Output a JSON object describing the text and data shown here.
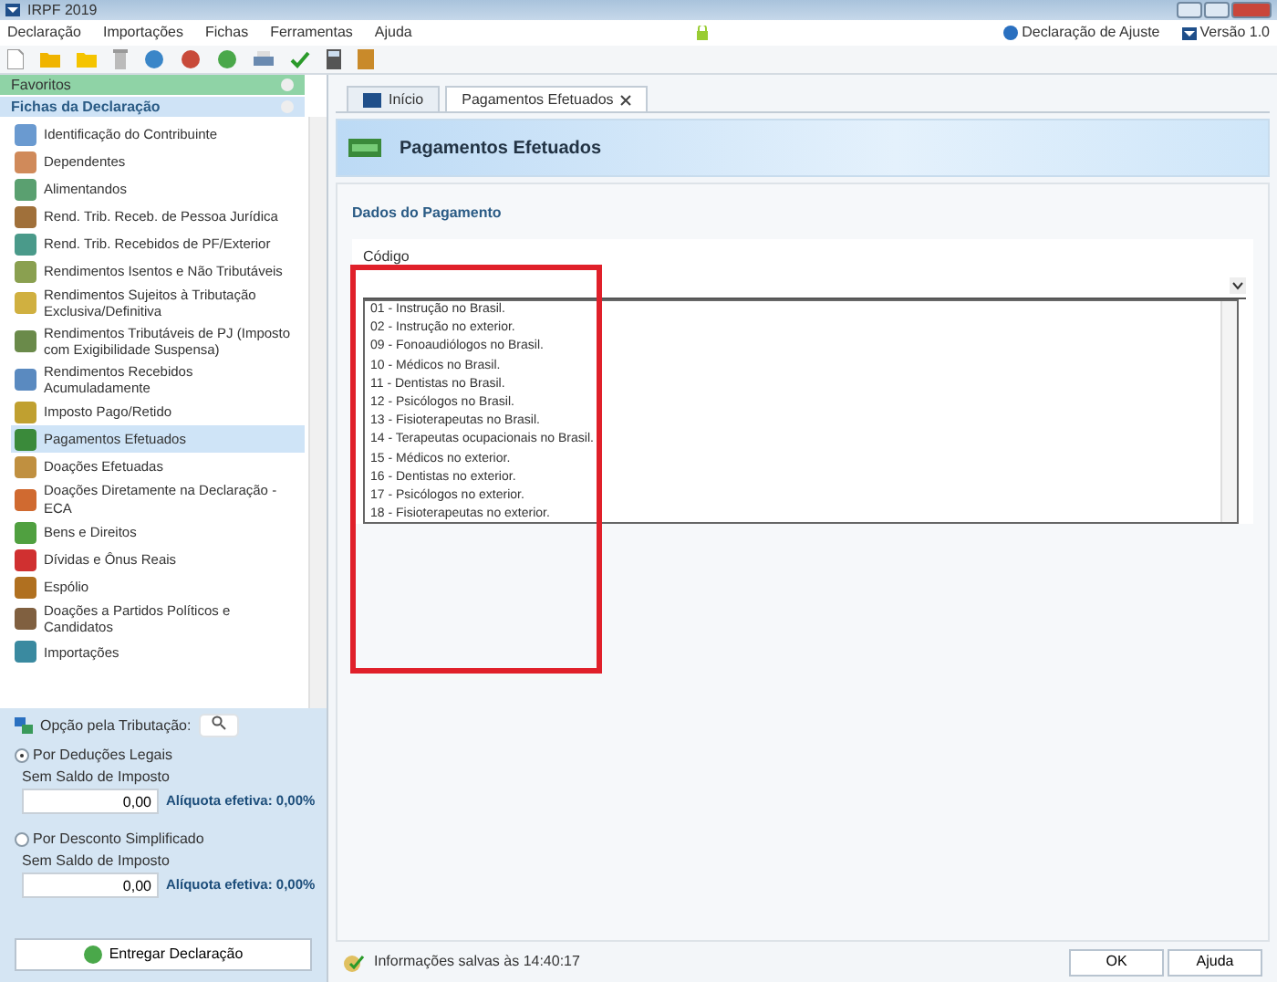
{
  "window": {
    "title": "IRPF 2019"
  },
  "menu": [
    "Declaração",
    "Importações",
    "Fichas",
    "Ferramentas",
    "Ajuda"
  ],
  "header_right": {
    "declaration": "Declaração de Ajuste",
    "version": "Versão 1.0"
  },
  "sidebar": {
    "favorites": "Favoritos",
    "section": "Fichas da Declaração",
    "items": [
      {
        "label": "Identificação do Contribuinte",
        "selected": false
      },
      {
        "label": "Dependentes",
        "selected": false
      },
      {
        "label": "Alimentandos",
        "selected": false
      },
      {
        "label": "Rend. Trib. Receb. de Pessoa Jurídica",
        "selected": false
      },
      {
        "label": "Rend. Trib. Recebidos de PF/Exterior",
        "selected": false
      },
      {
        "label": "Rendimentos Isentos e Não Tributáveis",
        "selected": false
      },
      {
        "label": "Rendimentos Sujeitos à Tributação Exclusiva/Definitiva",
        "selected": false
      },
      {
        "label": "Rendimentos Tributáveis de PJ (Imposto com Exigibilidade Suspensa)",
        "selected": false
      },
      {
        "label": "Rendimentos Recebidos Acumuladamente",
        "selected": false
      },
      {
        "label": "Imposto Pago/Retido",
        "selected": false
      },
      {
        "label": "Pagamentos Efetuados",
        "selected": true
      },
      {
        "label": "Doações Efetuadas",
        "selected": false
      },
      {
        "label": "Doações Diretamente na Declaração - ECA",
        "selected": false
      },
      {
        "label": "Bens e Direitos",
        "selected": false
      },
      {
        "label": "Dívidas e Ônus Reais",
        "selected": false
      },
      {
        "label": "Espólio",
        "selected": false
      },
      {
        "label": "Doações a Partidos Políticos e Candidatos",
        "selected": false
      },
      {
        "label": "Importações",
        "selected": false
      }
    ]
  },
  "taxation": {
    "title": "Opção pela Tributação:",
    "options": [
      {
        "label": "Por Deduções Legais",
        "selected": true,
        "sublabel": "Sem Saldo de Imposto",
        "value": "0,00",
        "rate": "Alíquota efetiva: 0,00%"
      },
      {
        "label": "Por Desconto Simplificado",
        "selected": false,
        "sublabel": "Sem Saldo de Imposto",
        "value": "0,00",
        "rate": "Alíquota efetiva: 0,00%"
      }
    ],
    "submit": "Entregar Declaração"
  },
  "tabs": [
    {
      "label": "Início",
      "selected": false,
      "closable": false
    },
    {
      "label": "Pagamentos Efetuados",
      "selected": true,
      "closable": true
    }
  ],
  "page": {
    "title": "Pagamentos Efetuados",
    "section": "Dados do Pagamento",
    "field_label": "Código",
    "dropdown_options": [
      "01 - Instrução no Brasil.",
      "02 - Instrução no exterior.",
      "09 - Fonoaudiólogos no Brasil.",
      "10 - Médicos no Brasil.",
      "11 - Dentistas no Brasil.",
      "12 - Psicólogos no Brasil.",
      "13 - Fisioterapeutas no Brasil.",
      "14 - Terapeutas ocupacionais no Brasil.",
      "15 - Médicos no exterior.",
      "16 - Dentistas no exterior.",
      "17 - Psicólogos no exterior.",
      "18 - Fisioterapeutas no exterior."
    ]
  },
  "status_bar": {
    "message": "Informações salvas às 14:40:17",
    "buttons": [
      "OK",
      "Ajuda"
    ]
  }
}
